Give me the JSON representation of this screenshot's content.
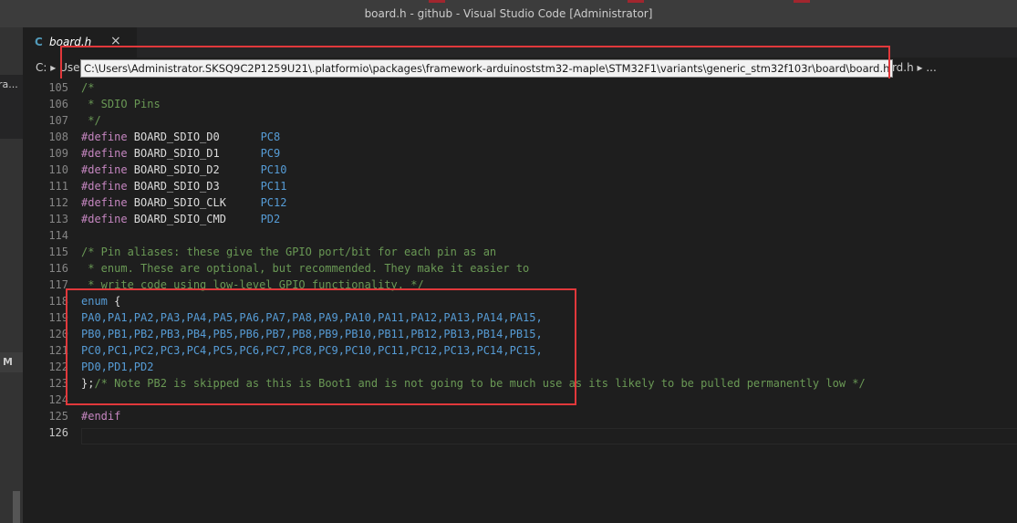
{
  "window": {
    "title": "board.h - github - Visual Studio Code [Administrator]"
  },
  "tab": {
    "lang_icon": "C",
    "filename": "board.h",
    "close": "×"
  },
  "breadcrumb": {
    "left": "C: ▸ Use",
    "right_icon": "C",
    "right": "board.h ▸ ..."
  },
  "tooltip": {
    "path": "C:\\Users\\Administrator.SKSQ9C2P1259U21\\.platformio\\packages\\framework-arduinoststm32-maple\\STM32F1\\variants\\generic_stm32f103r\\board\\board.h"
  },
  "sidebar": {
    "tab_label": "ra...",
    "badge": "M"
  },
  "editor": {
    "lines": [
      {
        "n": "105",
        "text": "/*"
      },
      {
        "n": "106",
        "text": " * SDIO Pins"
      },
      {
        "n": "107",
        "text": " */"
      },
      {
        "n": "108",
        "kw": "#define",
        "id": " BOARD_SDIO_D0",
        "val": "PC8"
      },
      {
        "n": "109",
        "kw": "#define",
        "id": " BOARD_SDIO_D1",
        "val": "PC9"
      },
      {
        "n": "110",
        "kw": "#define",
        "id": " BOARD_SDIO_D2",
        "val": "PC10"
      },
      {
        "n": "111",
        "kw": "#define",
        "id": " BOARD_SDIO_D3",
        "val": "PC11"
      },
      {
        "n": "112",
        "kw": "#define",
        "id": " BOARD_SDIO_CLK",
        "val": "PC12"
      },
      {
        "n": "113",
        "kw": "#define",
        "id": " BOARD_SDIO_CMD",
        "val": "PD2"
      },
      {
        "n": "114",
        "text": ""
      },
      {
        "n": "115",
        "text": "/* Pin aliases: these give the GPIO port/bit for each pin as an"
      },
      {
        "n": "116",
        "text": " * enum. These are optional, but recommended. They make it easier to"
      },
      {
        "n": "117",
        "text": " * write code using low-level GPIO functionality. */"
      },
      {
        "n": "118",
        "enum": "enum",
        "brace": " {"
      },
      {
        "n": "119",
        "text": "PA0,PA1,PA2,PA3,PA4,PA5,PA6,PA7,PA8,PA9,PA10,PA11,PA12,PA13,PA14,PA15,"
      },
      {
        "n": "120",
        "text": "PB0,PB1,PB2,PB3,PB4,PB5,PB6,PB7,PB8,PB9,PB10,PB11,PB12,PB13,PB14,PB15,"
      },
      {
        "n": "121",
        "text": "PC0,PC1,PC2,PC3,PC4,PC5,PC6,PC7,PC8,PC9,PC10,PC11,PC12,PC13,PC14,PC15,"
      },
      {
        "n": "122",
        "text": "PD0,PD1,PD2"
      },
      {
        "n": "123",
        "close": "};",
        "comment": "/* Note PB2 is skipped as this is Boot1 and is not going to be much use as its likely to be pulled permanently low */"
      },
      {
        "n": "124",
        "text": ""
      },
      {
        "n": "125",
        "text": "#endif"
      },
      {
        "n": "126",
        "text": ""
      }
    ]
  },
  "colors": {
    "highlight": "#e1383b",
    "comment": "#6a9955",
    "keyword": "#c586c0",
    "value": "#569cd6"
  }
}
